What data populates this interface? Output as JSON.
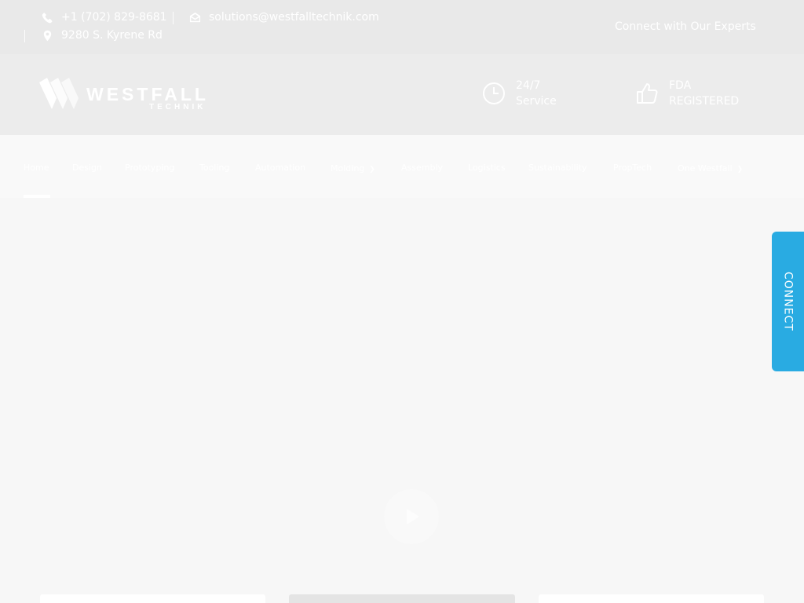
{
  "topbar": {
    "phone": "+1 (702) 829-8681",
    "email": "solutions@westfalltechnik.com",
    "address": "9280 S. Kyrene Rd",
    "cta": "Connect with Our Experts",
    "icons": {
      "phone": "phone-icon",
      "email": "envelope-icon",
      "address": "map-pin-icon"
    }
  },
  "header": {
    "logo_text": "WESTFALL",
    "logo_sub": "TECHNIK",
    "features": [
      {
        "icon": "clock-icon",
        "line1": "24/7",
        "line2": "Service"
      },
      {
        "icon": "thumbs-up-icon",
        "line1": "FDA",
        "line2": "REGISTERED"
      }
    ]
  },
  "nav": {
    "items": [
      {
        "label": "Home",
        "active": true
      },
      {
        "label": "Design"
      },
      {
        "label": "Prototyping"
      },
      {
        "label": "Tooling"
      },
      {
        "label": "Automation"
      },
      {
        "label": "Molding",
        "has_dropdown": true
      },
      {
        "label": "Assembly"
      },
      {
        "label": "Logistics"
      },
      {
        "label": "Sustainability"
      },
      {
        "label": "PropTech"
      },
      {
        "label": "One Westfall",
        "has_dropdown": true
      }
    ]
  },
  "side_tab": {
    "label": "CONNECT"
  },
  "colors": {
    "accent": "#29abe2",
    "overlay": "#ffffff"
  }
}
